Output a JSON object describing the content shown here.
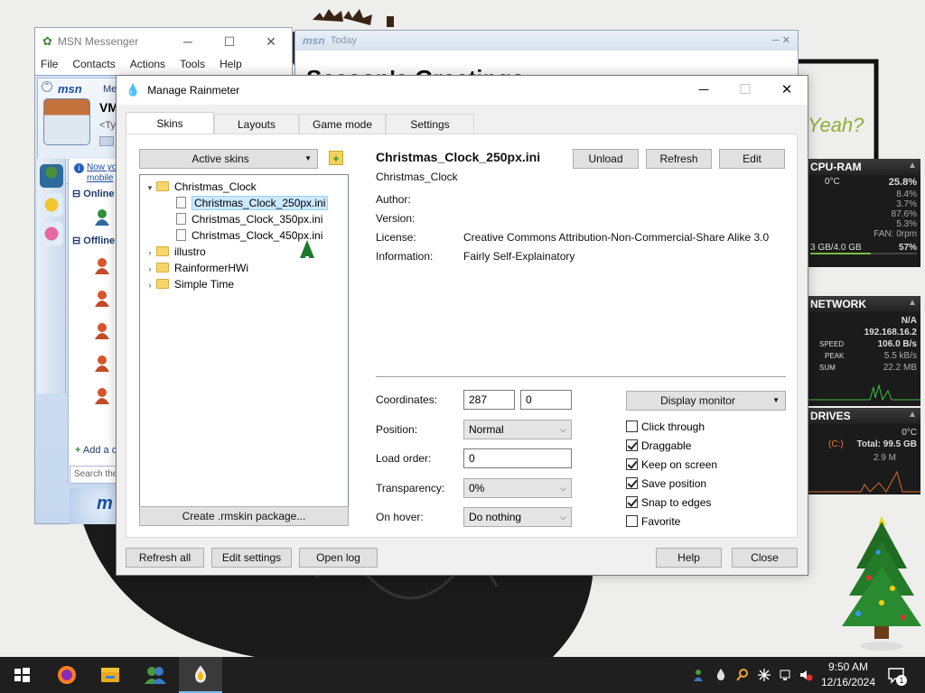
{
  "msn": {
    "title": "MSN Messenger",
    "menu": [
      "File",
      "Contacts",
      "Actions",
      "Tools",
      "Help"
    ],
    "logo": "msn",
    "header_partial": "Me",
    "display_name": "VM",
    "personal_message": "<Ty",
    "notice": "Now yo mobile",
    "groups": [
      "Online",
      "Offline"
    ],
    "add_contact": "Add a c",
    "search_placeholder": "Search the",
    "ad_text": "m"
  },
  "today": {
    "logo": "msn",
    "title": "Today",
    "headline": "Season's Greetings"
  },
  "sketch_text": "Yeah?",
  "gadgets": {
    "cpu": {
      "title": "CPU-RAM",
      "temp": "0°C",
      "cpu_pct": "25.8%",
      "cores": [
        "8.4%",
        "3.7%",
        "87.6%",
        "5.3%"
      ],
      "fan": "FAN: 0rpm",
      "ram": "3 GB/4.0 GB",
      "ram_pct": "57%"
    },
    "network": {
      "title": "NETWORK",
      "ext_ip": "N/A",
      "int_ip": "192.168.16.2",
      "speed_label": "SPEED",
      "speed": "106.0 B/s",
      "peak_label": "PEAK",
      "peak": "5.5 kB/s",
      "sum_label": "SUM",
      "sum": "22.2 MB"
    },
    "drives": {
      "title": "DRIVES",
      "temp": "0°C",
      "drive": "(C:)",
      "total": "Total: 99.5 GB",
      "used": "2.9 M"
    }
  },
  "rainmeter": {
    "title": "Manage Rainmeter",
    "tabs": [
      "Skins",
      "Layouts",
      "Game mode",
      "Settings"
    ],
    "active_tab": "Skins",
    "active_skins_label": "Active skins",
    "tree": [
      {
        "label": "Christmas_Clock",
        "type": "folder",
        "expanded": true
      },
      {
        "label": "Christmas_Clock_250px.ini",
        "type": "file",
        "selected": true
      },
      {
        "label": "Christmas_Clock_350px.ini",
        "type": "file"
      },
      {
        "label": "Christmas_Clock_450px.ini",
        "type": "file"
      },
      {
        "label": "illustro",
        "type": "folder"
      },
      {
        "label": "RainformerHWi",
        "type": "folder"
      },
      {
        "label": "Simple Time",
        "type": "folder"
      }
    ],
    "create_package": "Create .rmskin package...",
    "skin_file": "Christmas_Clock_250px.ini",
    "skin_folder": "Christmas_Clock",
    "buttons": {
      "unload": "Unload",
      "refresh": "Refresh",
      "edit": "Edit"
    },
    "meta_labels": {
      "author": "Author:",
      "version": "Version:",
      "license": "License:",
      "information": "Information:"
    },
    "meta_values": {
      "author": "",
      "version": "",
      "license": "Creative Commons Attribution-Non-Commercial-Share Alike 3.0",
      "information": "Fairly Self-Explainatory"
    },
    "settings": {
      "coordinates_label": "Coordinates:",
      "coord_x": "287",
      "coord_y": "0",
      "position_label": "Position:",
      "position": "Normal",
      "load_order_label": "Load order:",
      "load_order": "0",
      "transparency_label": "Transparency:",
      "transparency": "0%",
      "on_hover_label": "On hover:",
      "on_hover": "Do nothing",
      "display_monitor": "Display monitor"
    },
    "checkboxes": [
      {
        "label": "Click through",
        "checked": false
      },
      {
        "label": "Draggable",
        "checked": true
      },
      {
        "label": "Keep on screen",
        "checked": true
      },
      {
        "label": "Save position",
        "checked": true
      },
      {
        "label": "Snap to edges",
        "checked": true
      },
      {
        "label": "Favorite",
        "checked": false
      }
    ],
    "footer": {
      "refresh_all": "Refresh all",
      "edit_settings": "Edit settings",
      "open_log": "Open log",
      "help": "Help",
      "close": "Close"
    }
  },
  "taskbar": {
    "time": "9:50 AM",
    "date": "12/16/2024",
    "notification_count": "1"
  },
  "colors": {
    "accent": "#0078d7",
    "taskbar": "#1f1f1f",
    "dialog_bg": "#f0f0f0"
  }
}
